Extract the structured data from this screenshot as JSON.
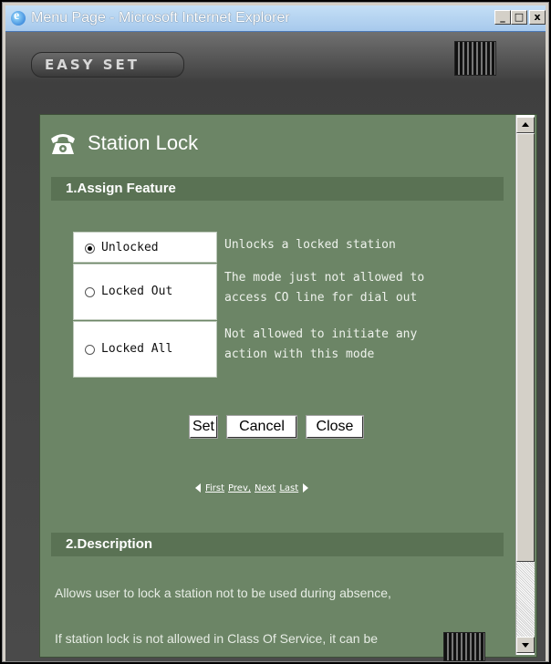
{
  "window": {
    "title": "Menu Page - Microsoft Internet Explorer",
    "controls": {
      "minimize": "_",
      "maximize": "□",
      "close": "x"
    }
  },
  "brand": {
    "logo_text": "EASY SET"
  },
  "page": {
    "title": "Station Lock",
    "icon": "telephone-icon"
  },
  "assign_section": {
    "heading": "1.Assign Feature",
    "options": [
      {
        "label": "Unlocked",
        "selected": true,
        "description": [
          "Unlocks a locked station"
        ]
      },
      {
        "label": "Locked Out",
        "selected": false,
        "description": [
          "The mode just not allowed to",
          "access CO line for dial out"
        ]
      },
      {
        "label": "Locked All",
        "selected": false,
        "description": [
          "Not allowed to initiate any",
          "action with this mode"
        ]
      }
    ],
    "buttons": {
      "set": "Set",
      "cancel": "Cancel",
      "close": "Close"
    }
  },
  "pager": {
    "first": "First",
    "prev": "Prev,",
    "next": "Next",
    "last": "Last"
  },
  "description_section": {
    "heading": "2.Description",
    "lines": [
      "Allows user to lock a station not to be used during absence,",
      "If station lock is not allowed in Class Of Service, it can be"
    ]
  },
  "colors": {
    "panel": "#6c8566",
    "section_bar": "#5a7254",
    "frame": "#4a4a4a"
  }
}
